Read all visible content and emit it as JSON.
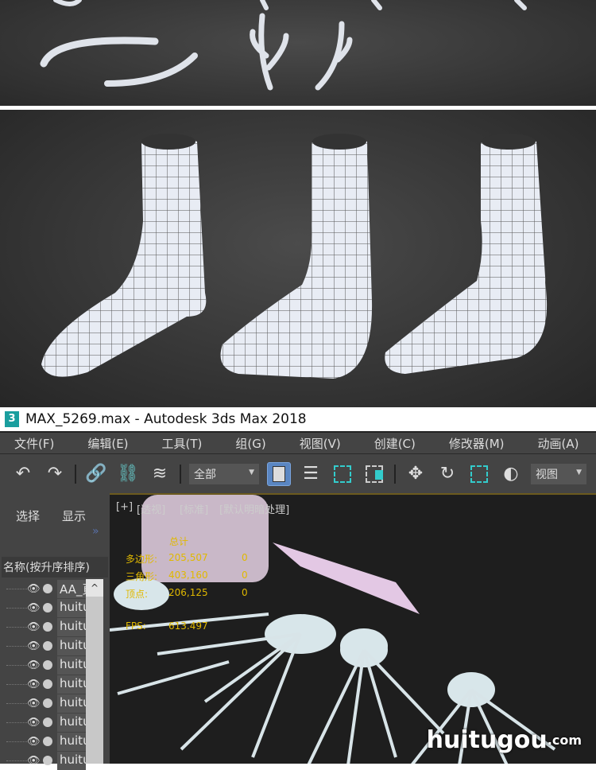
{
  "window": {
    "app_icon": "3",
    "title": "MAX_5269.max - Autodesk 3ds Max 2018"
  },
  "menu": [
    "文件(F)",
    "编辑(E)",
    "工具(T)",
    "组(G)",
    "视图(V)",
    "创建(C)",
    "修改器(M)",
    "动画(A)"
  ],
  "toolbar": {
    "filter_dropdown": "全部",
    "view_dropdown": "视图"
  },
  "scene_explorer": {
    "tabs": [
      "选择",
      "显示"
    ],
    "expand": "»",
    "column_header": "名称(按升序排序)",
    "scroll_up": "^",
    "items": [
      "AA_頁",
      "huitu",
      "huitu",
      "huitu",
      "huitu",
      "huitu",
      "huitu",
      "huitu",
      "huitu",
      "huitu"
    ]
  },
  "viewport": {
    "labels": [
      "[+]",
      "[透视]",
      "[标准]",
      "[默认明暗处理]"
    ],
    "stats": {
      "title": "总计",
      "rows": [
        {
          "label": "多边形:",
          "value": "205,507",
          "sel": "0"
        },
        {
          "label": "三角形:",
          "value": "403,160",
          "sel": "0"
        },
        {
          "label": "顶点:",
          "value": "206,125",
          "sel": "0"
        }
      ],
      "fps_label": "FPS:",
      "fps_value": "613.497"
    }
  },
  "watermark": {
    "name": "huitugou",
    "suffix": ".com"
  }
}
